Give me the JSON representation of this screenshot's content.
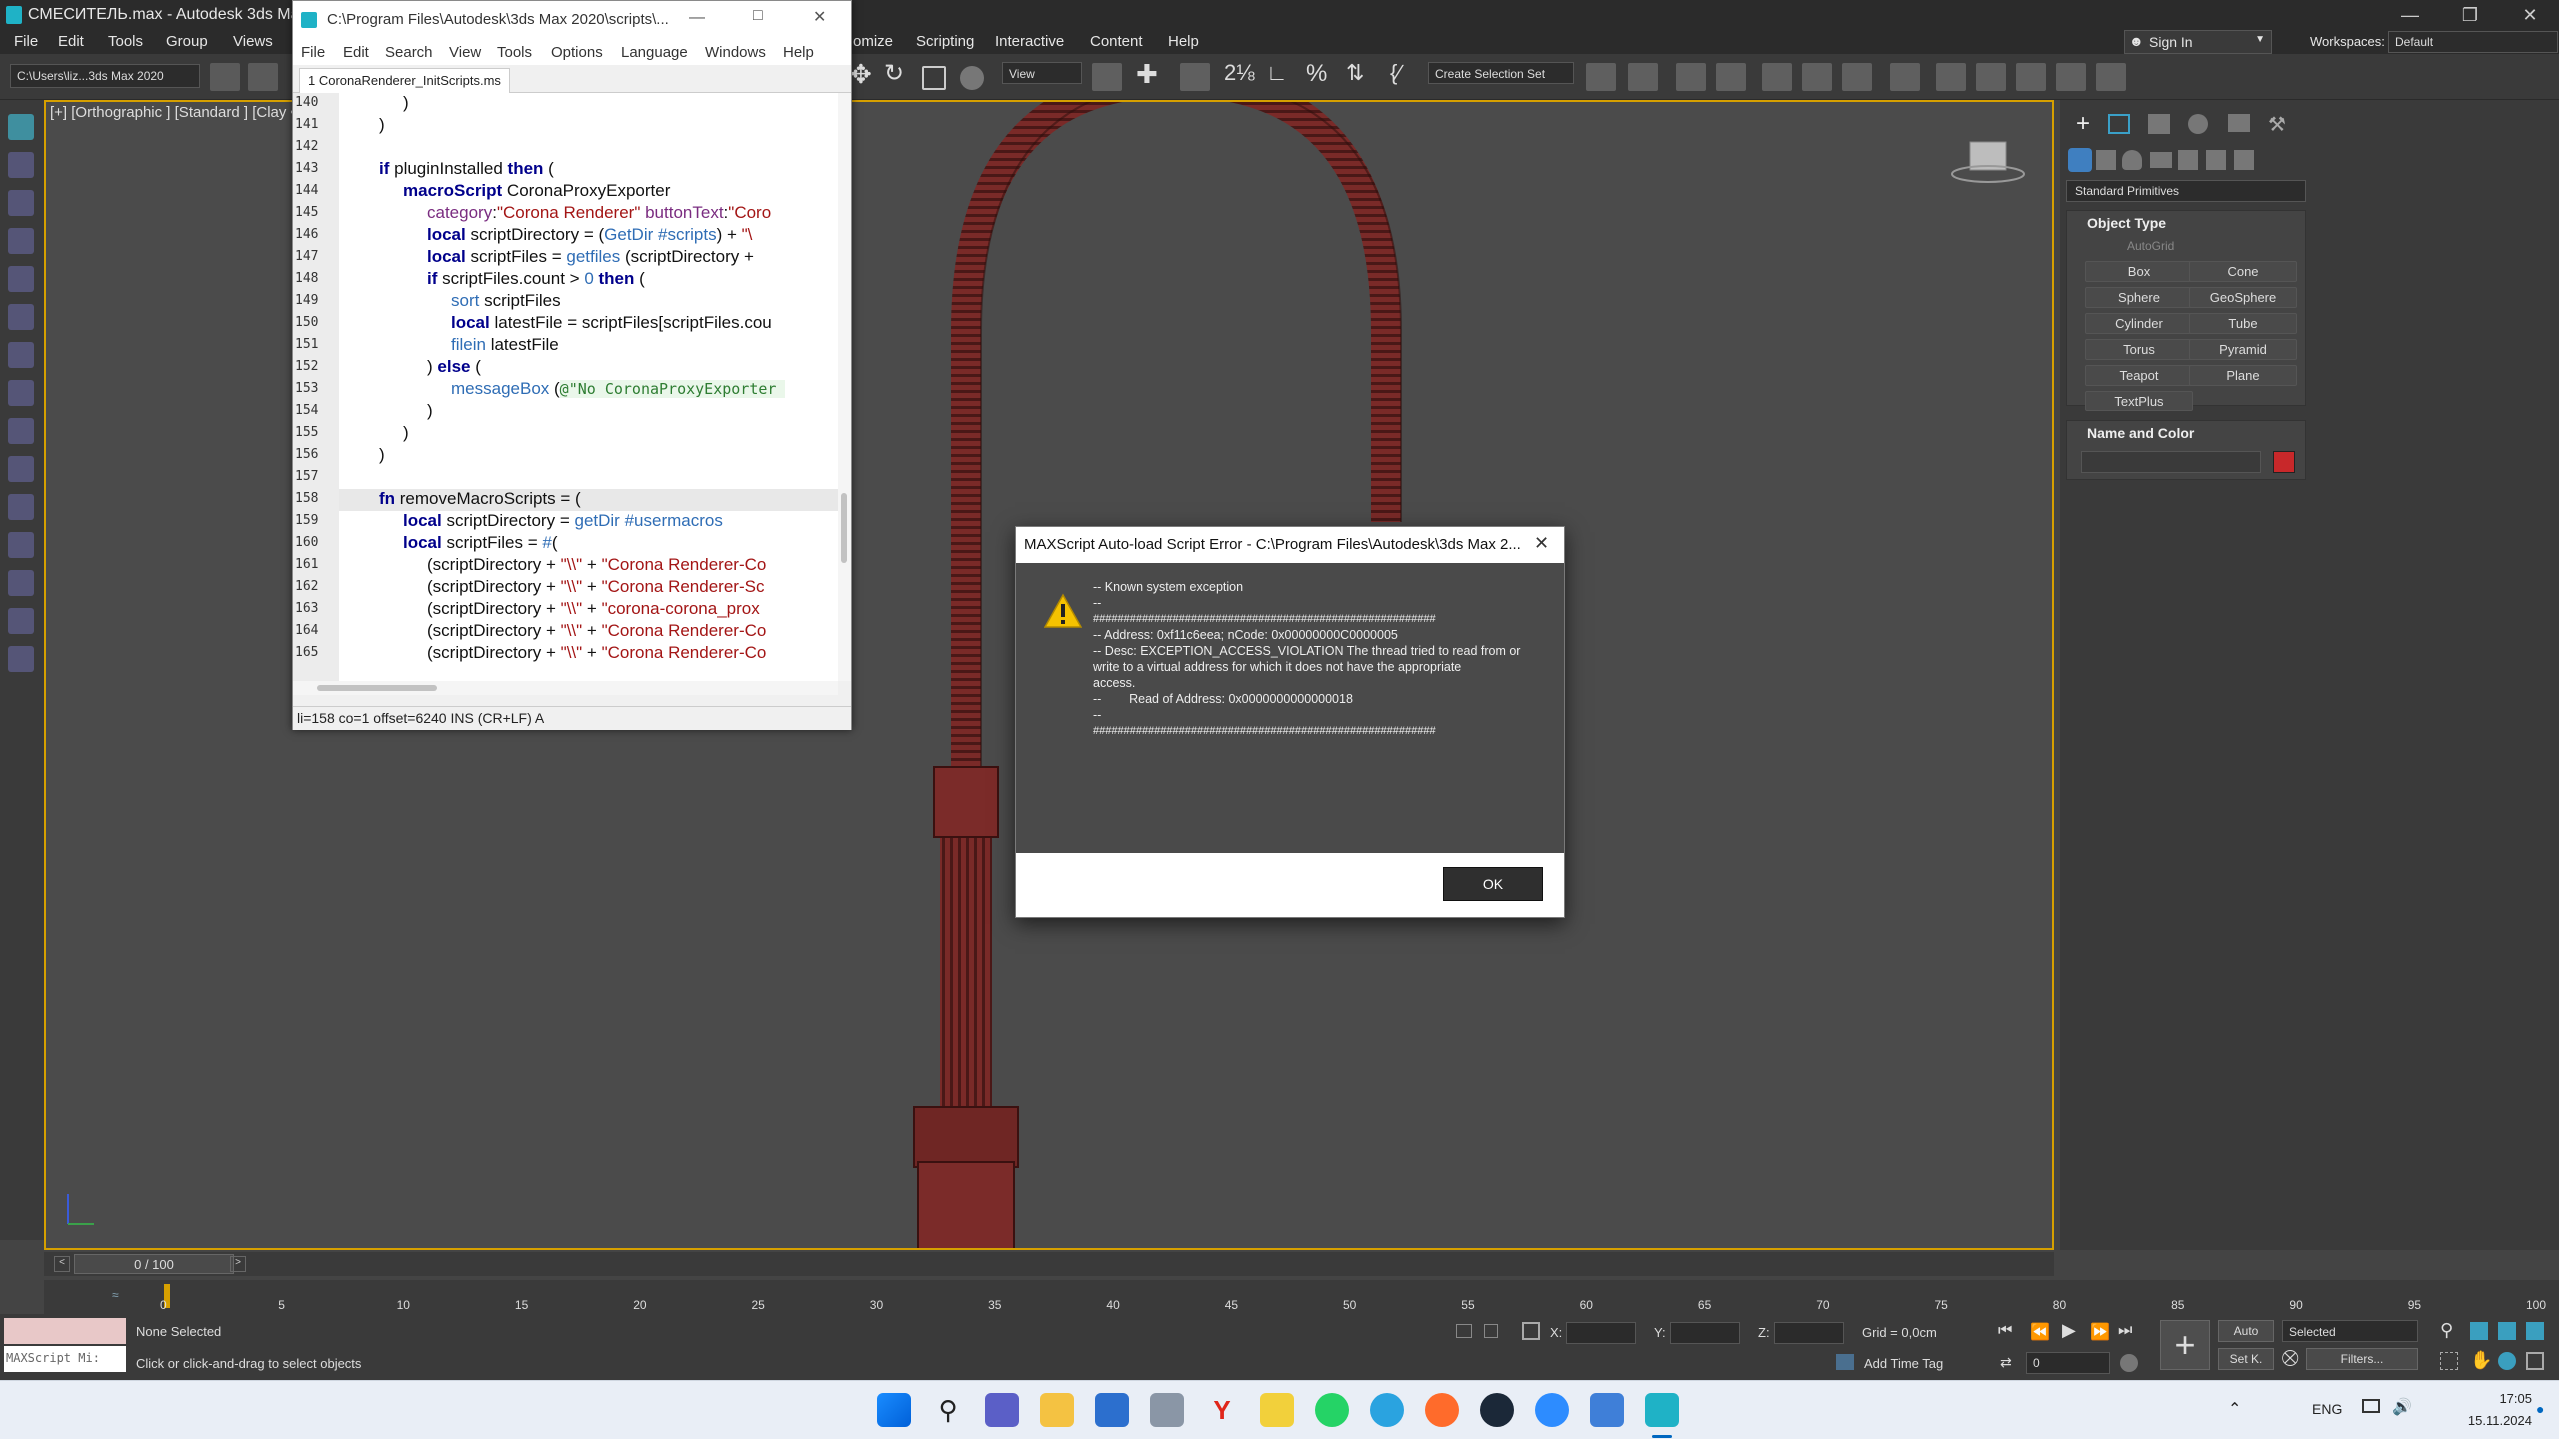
{
  "app": {
    "title": "СМЕСИТЕЛЬ.max - Autodesk 3ds Max 2",
    "menu": [
      "File",
      "Edit",
      "Tools",
      "Group",
      "Views",
      "omize",
      "Scripting",
      "Interactive",
      "Content",
      "Help"
    ],
    "sign_in": "Sign In",
    "workspaces_label": "Workspaces:",
    "workspace_value": "Default",
    "path_dropdown": "C:\\Users\\liz...3ds Max 2020",
    "view_dropdown": "View",
    "selection_set": "Create Selection Set"
  },
  "viewport": {
    "label": "[+] [Orthographic ] [Standard ] [Clay •"
  },
  "editor": {
    "title": "C:\\Program Files\\Autodesk\\3ds Max 2020\\scripts\\...",
    "menu": [
      "File",
      "Edit",
      "Search",
      "View",
      "Tools",
      "Options",
      "Language",
      "Windows",
      "Help"
    ],
    "tab": "1 CoronaRenderer_InitScripts.ms",
    "status": "li=158 co=1 offset=6240 INS (CR+LF) A",
    "line_numbers": [
      "140",
      "141",
      "142",
      "143",
      "144",
      "145",
      "146",
      "147",
      "148",
      "149",
      "150",
      "151",
      "152",
      "153",
      "154",
      "155",
      "156",
      "157",
      "158",
      "159",
      "160",
      "161",
      "162",
      "163",
      "164",
      "165"
    ]
  },
  "dialog": {
    "title": "MAXScript Auto-load Script Error - C:\\Program Files\\Autodesk\\3ds Max 2...",
    "lines": [
      "-- Known system exception",
      "--",
      "########################################################",
      "-- Address: 0xf11c6eea; nCode: 0x00000000C0000005",
      "-- Desc: EXCEPTION_ACCESS_VIOLATION The thread tried to read from or",
      "write to a virtual address for which it does not have the appropriate",
      "access.",
      "--        Read of Address: 0x0000000000000018",
      "--",
      "########################################################"
    ],
    "ok": "OK"
  },
  "panel": {
    "dropdown": "Standard Primitives",
    "object_type": "Object Type",
    "autogrid": "AutoGrid",
    "buttons": [
      "Box",
      "Cone",
      "Sphere",
      "GeoSphere",
      "Cylinder",
      "Tube",
      "Torus",
      "Pyramid",
      "Teapot",
      "Plane",
      "TextPlus"
    ],
    "name_color": "Name and Color",
    "swatch_color": "#c8282a"
  },
  "timeline": {
    "frame": "0 / 100",
    "ticks": [
      "0",
      "5",
      "10",
      "15",
      "20",
      "25",
      "30",
      "35",
      "40",
      "45",
      "50",
      "55",
      "60",
      "65",
      "70",
      "75",
      "80",
      "85",
      "90",
      "95",
      "100"
    ]
  },
  "status": {
    "maxscript": "MAXScript Mi:",
    "selected": "None Selected",
    "hint": "Click or click-and-drag to select objects",
    "x": "X:",
    "y": "Y:",
    "z": "Z:",
    "grid": "Grid = 0,0cm",
    "add_time_tag": "Add Time Tag",
    "auto": "Auto",
    "set_key": "Set K.",
    "selected_dd": "Selected",
    "filters": "Filters...",
    "frame_field": "0"
  },
  "taskbar": {
    "lang": "ENG",
    "time": "17:05",
    "date": "15.11.2024"
  }
}
